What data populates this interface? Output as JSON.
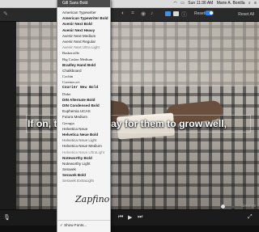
{
  "menubar": {
    "clock": "Sun 11:36 AM",
    "user": "Marie A. Bonilla"
  },
  "toolbar": {
    "reset_label": "Reset",
    "reset_all_label": "Reset All"
  },
  "video": {
    "caption": "If on, there's no way for them to grow well,"
  },
  "font_menu": {
    "selected": "Gill Sans Bold",
    "items": [
      "American Typewriter",
      "American Typewriter Bold",
      "Avenir Next Bold",
      "Avenir Next Heavy",
      "Avenir Next Medium",
      "Avenir Next Regular",
      "Avenir Next Ultra Light",
      "Baskerville",
      "Big Caslon Medium",
      "Bradley Hand Bold",
      "Chalkboard",
      "Cochin",
      "Copperplate",
      "Courier New Bold",
      "Didot",
      "DIN Alternate Bold",
      "DIN Condensed Bold",
      "Euphemia UCAS",
      "Futura Medium",
      "Georgia",
      "Helvetica Neue",
      "Helvetica Neue Bold",
      "Helvetica Neue Light",
      "Helvetica Neue Medium",
      "Helvetica Neue UltraLight",
      "Noteworthy Bold",
      "Noteworthy Light",
      "Seravek",
      "Seravek Bold",
      "Seravek ExtraLight"
    ],
    "signature_sample": "Zapfino",
    "show_fonts": "Show Fonts..."
  }
}
